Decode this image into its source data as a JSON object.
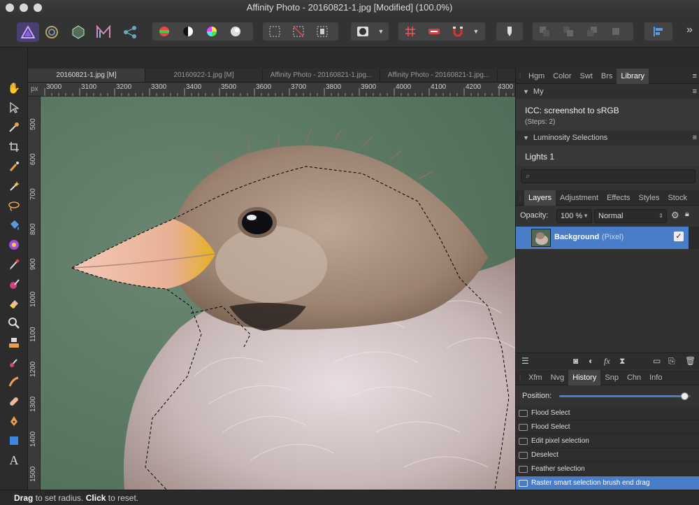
{
  "window": {
    "title": "Affinity Photo - 20160821-1.jpg [Modified] (100.0%)"
  },
  "toolbar": {
    "personas": [
      "photo-persona-icon",
      "liquify-persona-icon",
      "develop-persona-icon",
      "tone-mapping-persona-icon",
      "export-persona-icon"
    ],
    "overflow_label": "»"
  },
  "tools": [
    "view-tool-icon",
    "move-tool-icon",
    "color-picker-icon",
    "crop-tool-icon",
    "selection-brush-icon",
    "flood-select-icon",
    "freehand-selection-icon",
    "fill-tool-icon",
    "gradient-tool-icon",
    "paint-brush-icon",
    "erase-brush-icon",
    "eraser-icon",
    "zoom-tool-icon",
    "clone-brush-icon",
    "dodge-brush-icon",
    "smudge-brush-icon",
    "healing-brush-icon",
    "pen-tool-icon",
    "rectangle-tool-icon",
    "text-tool-icon"
  ],
  "documents": {
    "tabs": [
      {
        "label": "20160821-1.jpg [M]",
        "active": true
      },
      {
        "label": "20160922-1.jpg [M]",
        "active": false
      },
      {
        "label": "Affinity Photo - 20160821-1.jpg...",
        "active": false
      },
      {
        "label": "Affinity Photo - 20160821-1.jpg...",
        "active": false
      }
    ]
  },
  "ruler": {
    "unit": "px",
    "horizontal": [
      "3000",
      "3100",
      "3200",
      "3300",
      "3400",
      "3500",
      "3600",
      "3700",
      "3800",
      "3900",
      "4000",
      "4100",
      "4200",
      "4300"
    ],
    "vertical": [
      "500",
      "600",
      "700",
      "800",
      "900",
      "1000",
      "1100",
      "1200",
      "1300",
      "1400",
      "1500"
    ]
  },
  "top_panel": {
    "tabs": [
      "Hgm",
      "Color",
      "Swt",
      "Brs",
      "Library"
    ],
    "active_tab": "Library",
    "sections": [
      {
        "title": "My",
        "item_title": "ICC: screenshot to sRGB",
        "item_sub": "(Steps: 2)"
      },
      {
        "title": "Luminosity Selections",
        "item_title": "Lights 1"
      }
    ],
    "search_placeholder": ""
  },
  "layers_panel": {
    "tabs": [
      "Layers",
      "Adjustment",
      "Effects",
      "Styles",
      "Stock"
    ],
    "active_tab": "Layers",
    "opacity_label": "Opacity:",
    "opacity_value": "100 %",
    "blend_mode": "Normal",
    "layers": [
      {
        "name": "Background",
        "type": "(Pixel)",
        "visible": true
      }
    ]
  },
  "history_panel": {
    "tabs": [
      "Xfm",
      "Nvg",
      "History",
      "Snp",
      "Chn",
      "Info"
    ],
    "active_tab": "History",
    "position_label": "Position:",
    "position": 0.95,
    "items": [
      {
        "label": "Flood Select",
        "active": false
      },
      {
        "label": "Flood Select",
        "active": false
      },
      {
        "label": "Edit pixel selection",
        "active": false
      },
      {
        "label": "Deselect",
        "active": false
      },
      {
        "label": "Feather selection",
        "active": false
      },
      {
        "label": "Raster smart selection brush end drag",
        "active": true
      }
    ]
  },
  "status": {
    "action1": "Drag",
    "text1": "to set radius.",
    "action2": "Click",
    "text2": "to reset."
  },
  "colors": {
    "accent": "#4a7dc8",
    "background_green": "#5e7a66"
  }
}
